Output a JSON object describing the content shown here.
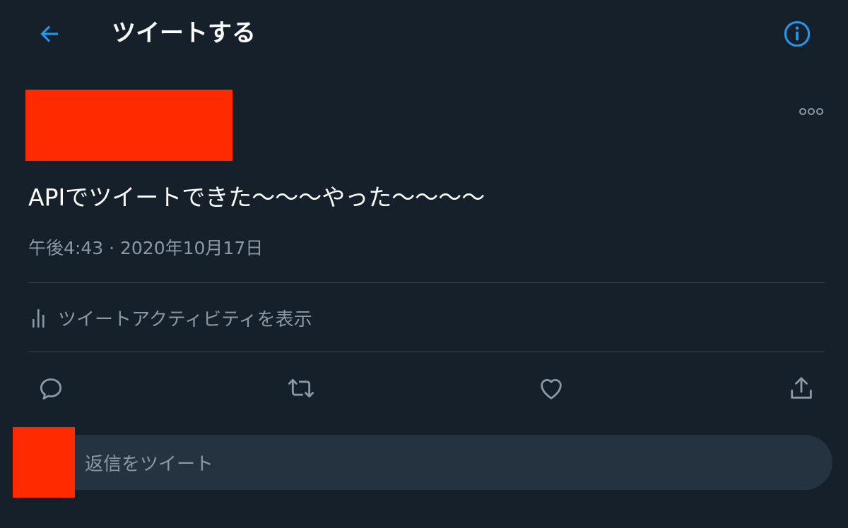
{
  "header": {
    "title": "ツイートする",
    "back_icon": "arrow-left-icon",
    "info_icon": "info-icon"
  },
  "tweet": {
    "text": "APIでツイートできた〜〜〜やった〜〜〜〜",
    "timestamp": "午後4:43 · 2020年10月17日",
    "more_icon": "more-horizontal-icon"
  },
  "activity": {
    "label": "ツイートアクティビティを表示",
    "icon": "bar-chart-icon"
  },
  "actions": {
    "reply_icon": "reply-icon",
    "retweet_icon": "retweet-icon",
    "like_icon": "heart-icon",
    "share_icon": "share-icon"
  },
  "reply_bar": {
    "placeholder": "返信をツイート"
  },
  "colors": {
    "background": "#15202b",
    "accent": "#1d9bf0",
    "secondary_text": "#8b98a5",
    "divider": "#38444d",
    "reply_field": "#253341",
    "redaction": "#ff2a00"
  }
}
